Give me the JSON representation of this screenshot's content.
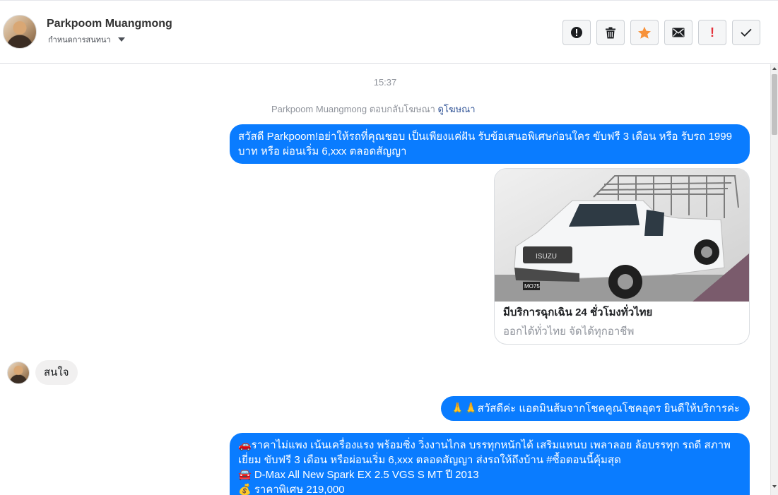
{
  "header": {
    "contact_name": "Parkpoom Muangmong",
    "conversation_menu": "กำหนดการสนทนา",
    "actions": [
      {
        "name": "report-icon",
        "label": ""
      },
      {
        "name": "delete-icon",
        "label": ""
      },
      {
        "name": "star-icon",
        "label": ""
      },
      {
        "name": "mail-icon",
        "label": ""
      },
      {
        "name": "important-icon",
        "label": "!"
      },
      {
        "name": "check-icon",
        "label": ""
      }
    ]
  },
  "thread": {
    "timestamp": "15:37",
    "ad_reply": {
      "text": "Parkpoom Muangmong ตอบกลับโฆษณา",
      "link": "ดูโฆษณา"
    },
    "messages": {
      "out_1": "สวัสดี Parkpoom!อย่าให้รถที่คุณชอบ เป็นเพียงแค่ฝัน รับข้อเสนอพิเศษก่อนใคร ขับฟรี 3 เดือน หรือ รับรถ 1999 บาท หรือ ผ่อนเริ่ม 6,xxx ตลอดสัญญา",
      "card_title": "มีบริการฉุกเฉิน 24 ชั่วโมงทั่วไทย",
      "card_subtitle": "ออกได้ทั่วไทย จัดได้ทุกอาชีพ",
      "in_1": "สนใจ",
      "out_2": "🙏🙏สวัสดีค่ะ แอดมินส้มจากโชคคูณโชคอุดร ยินดีให้บริการค่ะ",
      "out_3_line1": "🚗ราคาไม่แพง เน้นเครื่องแรง พร้อมซิ่ง วิ่งงานไกล บรรทุกหนักได้ เสริมแหนบ เพลาลอย ล้อบรรทุก รถดี สภาพเยี่ยม ขับฟรี 3 เดือน หรือผ่อนเริ่ม 6,xxx ตลอดสัญญา ส่งรถให้ถึงบ้าน #ซื้อตอนนี้คุ้มสุด",
      "out_3_line2": "🚘 D-Max All New Spark EX 2.5 VGS S MT ปี 2013",
      "out_3_line3": "💰 ราคาพิเศษ 219,000"
    },
    "car_plate": "MO75",
    "car_brand": "ISUZU"
  },
  "colors": {
    "outgoing_bubble": "#0a7cff",
    "incoming_bubble": "#f1f0f0",
    "star": "#f7923a",
    "important": "#e4303a"
  }
}
